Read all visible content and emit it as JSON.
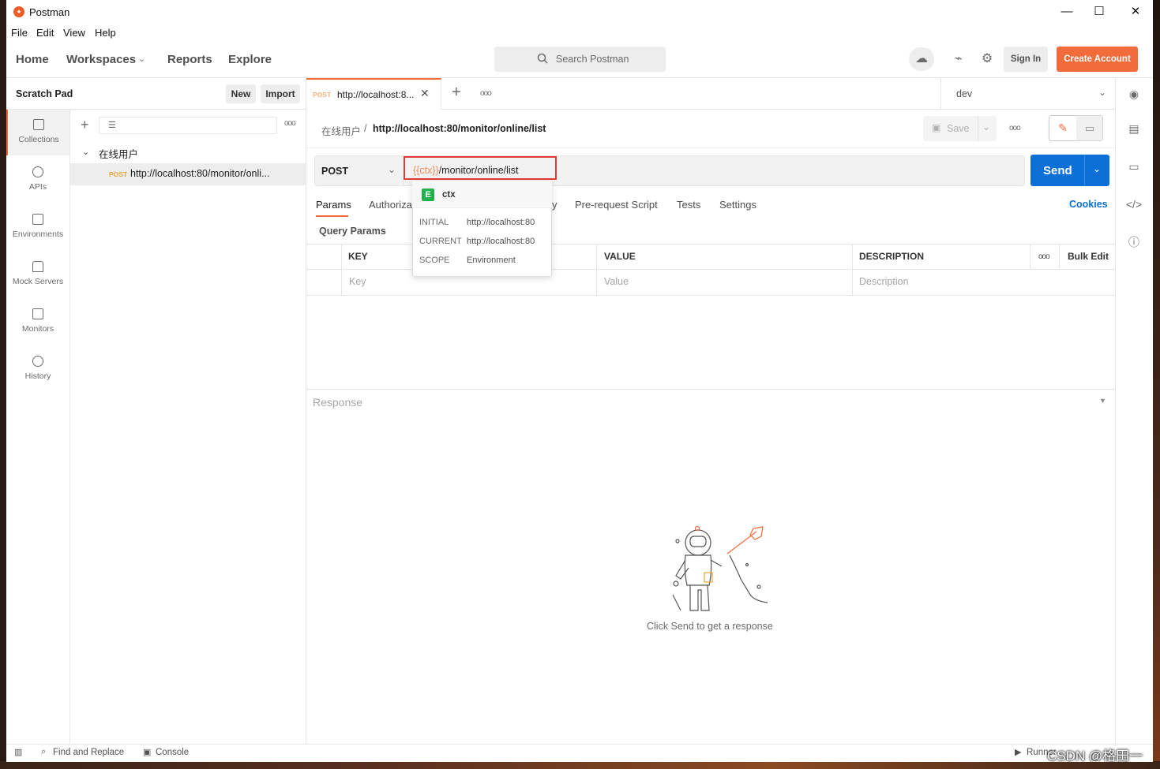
{
  "window": {
    "title": "Postman",
    "controls": {
      "minimize": "—",
      "maximize": "☐",
      "close": "✕"
    }
  },
  "menubar": [
    "File",
    "Edit",
    "View",
    "Help"
  ],
  "header": {
    "home": "Home",
    "workspaces": "Workspaces",
    "reports": "Reports",
    "explore": "Explore",
    "search_placeholder": "Search Postman",
    "sign_in": "Sign In",
    "create_account": "Create Account"
  },
  "sidebar": {
    "title": "Scratch Pad",
    "new_label": "New",
    "import_label": "Import",
    "rail": [
      {
        "label": "Collections",
        "icon": "collections-icon",
        "active": true
      },
      {
        "label": "APIs",
        "icon": "apis-icon"
      },
      {
        "label": "Environments",
        "icon": "environments-icon"
      },
      {
        "label": "Mock Servers",
        "icon": "mock-servers-icon"
      },
      {
        "label": "Monitors",
        "icon": "monitors-icon"
      },
      {
        "label": "History",
        "icon": "history-icon"
      }
    ],
    "collection_name": "在线用户",
    "request_method": "POST",
    "request_url": "http://localhost:80/monitor/onli..."
  },
  "tabs": {
    "active_method": "POST",
    "active_title": "http://localhost:8...",
    "environment": "dev"
  },
  "request": {
    "breadcrumb_collection": "在线用户",
    "breadcrumb_separator": "/",
    "breadcrumb_request": "http://localhost:80/monitor/online/list",
    "save_label": "Save",
    "method": "POST",
    "url_variable": "{{ctx}}",
    "url_path": "/monitor/online/list",
    "send_label": "Send",
    "tabs": [
      "Params",
      "Authorizat",
      "y",
      "Pre-request Script",
      "Tests",
      "Settings"
    ],
    "cookies_label": "Cookies",
    "query_params_label": "Query Params",
    "columns": {
      "key": "KEY",
      "value": "VALUE",
      "description": "DESCRIPTION",
      "bulk_edit": "Bulk Edit"
    },
    "row_placeholders": {
      "key": "Key",
      "value": "Value",
      "description": "Description"
    }
  },
  "variable_popover": {
    "badge": "E",
    "name": "ctx",
    "rows": [
      {
        "label": "INITIAL",
        "value": "http://localhost:80"
      },
      {
        "label": "CURRENT",
        "value": "http://localhost:80"
      },
      {
        "label": "SCOPE",
        "value": "Environment"
      }
    ]
  },
  "response": {
    "label": "Response",
    "empty_message": "Click Send to get a response"
  },
  "statusbar": {
    "find_replace": "Find and Replace",
    "console": "Console",
    "runner": "Runner",
    "watermark": "CSDN @格田一物"
  },
  "colors": {
    "accent": "#f26b3a",
    "send_blue": "#0b6fd6",
    "post_orange": "#e8a53a",
    "highlight_red": "#e53935",
    "env_green": "#22b14c"
  }
}
